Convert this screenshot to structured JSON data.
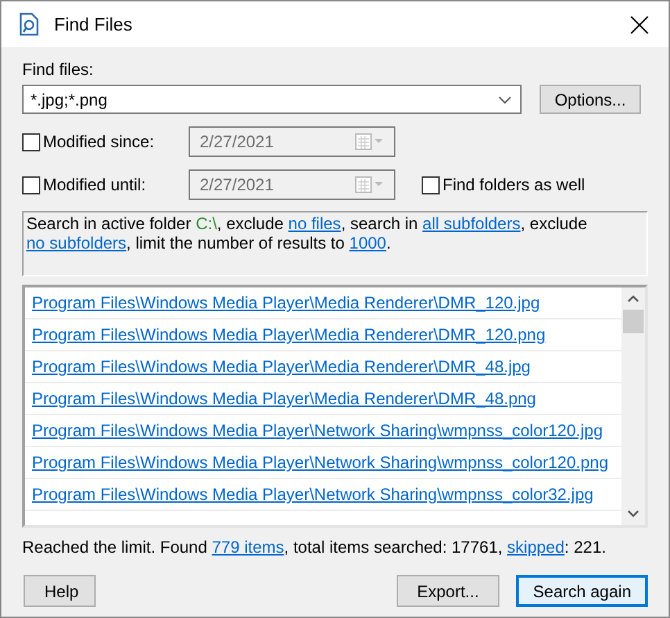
{
  "window": {
    "title": "Find Files"
  },
  "find_files": {
    "label": "Find files:",
    "value": "*.jpg;*.png"
  },
  "options_button": "Options...",
  "modified_since": {
    "label": "Modified since:",
    "checked": false,
    "date": "2/27/2021"
  },
  "modified_until": {
    "label": "Modified until:",
    "checked": false,
    "date": "2/27/2021"
  },
  "find_folders": {
    "label": "Find folders as well",
    "checked": false
  },
  "summary": [
    {
      "kind": "text",
      "text": "Search in active folder "
    },
    {
      "kind": "folder",
      "text": "C:\\",
      "color": "#2e8b2e"
    },
    {
      "kind": "text",
      "text": ", exclude "
    },
    {
      "kind": "link",
      "text": "no files"
    },
    {
      "kind": "text",
      "text": ", search in "
    },
    {
      "kind": "link",
      "text": "all subfolders"
    },
    {
      "kind": "text",
      "text": ", exclude "
    },
    {
      "kind": "link",
      "text": "no subfolders"
    },
    {
      "kind": "text",
      "text": ", limit the number of results to "
    },
    {
      "kind": "link",
      "text": "1000"
    },
    {
      "kind": "text",
      "text": "."
    }
  ],
  "results": [
    "Program Files\\Windows Media Player\\Media Renderer\\DMR_120.jpg",
    "Program Files\\Windows Media Player\\Media Renderer\\DMR_120.png",
    "Program Files\\Windows Media Player\\Media Renderer\\DMR_48.jpg",
    "Program Files\\Windows Media Player\\Media Renderer\\DMR_48.png",
    "Program Files\\Windows Media Player\\Network Sharing\\wmpnss_color120.jpg",
    "Program Files\\Windows Media Player\\Network Sharing\\wmpnss_color120.png",
    "Program Files\\Windows Media Player\\Network Sharing\\wmpnss_color32.jpg"
  ],
  "status": [
    {
      "kind": "text",
      "text": "Reached the limit. Found "
    },
    {
      "kind": "link",
      "text": "779 items"
    },
    {
      "kind": "text",
      "text": ", total items searched: 17761, "
    },
    {
      "kind": "link",
      "text": "skipped"
    },
    {
      "kind": "text",
      "text": ": 221."
    }
  ],
  "buttons": [
    {
      "label": "Help",
      "default": false
    },
    {
      "label": "Export...",
      "default": false
    },
    {
      "label": "Search again",
      "default": true
    }
  ]
}
